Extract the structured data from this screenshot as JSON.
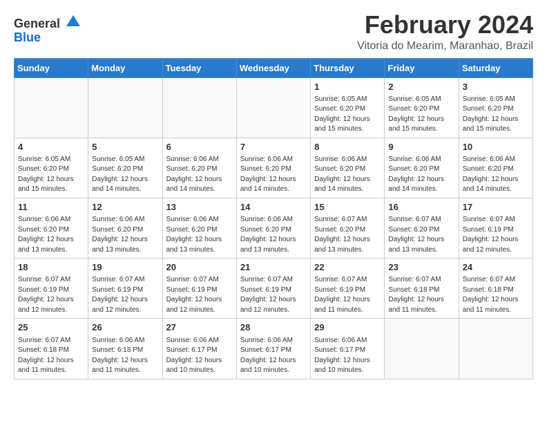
{
  "header": {
    "logo_line1": "General",
    "logo_line2": "Blue",
    "main_title": "February 2024",
    "subtitle": "Vitoria do Mearim, Maranhao, Brazil"
  },
  "weekdays": [
    "Sunday",
    "Monday",
    "Tuesday",
    "Wednesday",
    "Thursday",
    "Friday",
    "Saturday"
  ],
  "weeks": [
    [
      {
        "day": "",
        "info": ""
      },
      {
        "day": "",
        "info": ""
      },
      {
        "day": "",
        "info": ""
      },
      {
        "day": "",
        "info": ""
      },
      {
        "day": "1",
        "info": "Sunrise: 6:05 AM\nSunset: 6:20 PM\nDaylight: 12 hours\nand 15 minutes."
      },
      {
        "day": "2",
        "info": "Sunrise: 6:05 AM\nSunset: 6:20 PM\nDaylight: 12 hours\nand 15 minutes."
      },
      {
        "day": "3",
        "info": "Sunrise: 6:05 AM\nSunset: 6:20 PM\nDaylight: 12 hours\nand 15 minutes."
      }
    ],
    [
      {
        "day": "4",
        "info": "Sunrise: 6:05 AM\nSunset: 6:20 PM\nDaylight: 12 hours\nand 15 minutes."
      },
      {
        "day": "5",
        "info": "Sunrise: 6:05 AM\nSunset: 6:20 PM\nDaylight: 12 hours\nand 14 minutes."
      },
      {
        "day": "6",
        "info": "Sunrise: 6:06 AM\nSunset: 6:20 PM\nDaylight: 12 hours\nand 14 minutes."
      },
      {
        "day": "7",
        "info": "Sunrise: 6:06 AM\nSunset: 6:20 PM\nDaylight: 12 hours\nand 14 minutes."
      },
      {
        "day": "8",
        "info": "Sunrise: 6:06 AM\nSunset: 6:20 PM\nDaylight: 12 hours\nand 14 minutes."
      },
      {
        "day": "9",
        "info": "Sunrise: 6:06 AM\nSunset: 6:20 PM\nDaylight: 12 hours\nand 14 minutes."
      },
      {
        "day": "10",
        "info": "Sunrise: 6:06 AM\nSunset: 6:20 PM\nDaylight: 12 hours\nand 14 minutes."
      }
    ],
    [
      {
        "day": "11",
        "info": "Sunrise: 6:06 AM\nSunset: 6:20 PM\nDaylight: 12 hours\nand 13 minutes."
      },
      {
        "day": "12",
        "info": "Sunrise: 6:06 AM\nSunset: 6:20 PM\nDaylight: 12 hours\nand 13 minutes."
      },
      {
        "day": "13",
        "info": "Sunrise: 6:06 AM\nSunset: 6:20 PM\nDaylight: 12 hours\nand 13 minutes."
      },
      {
        "day": "14",
        "info": "Sunrise: 6:06 AM\nSunset: 6:20 PM\nDaylight: 12 hours\nand 13 minutes."
      },
      {
        "day": "15",
        "info": "Sunrise: 6:07 AM\nSunset: 6:20 PM\nDaylight: 12 hours\nand 13 minutes."
      },
      {
        "day": "16",
        "info": "Sunrise: 6:07 AM\nSunset: 6:20 PM\nDaylight: 12 hours\nand 13 minutes."
      },
      {
        "day": "17",
        "info": "Sunrise: 6:07 AM\nSunset: 6:19 PM\nDaylight: 12 hours\nand 12 minutes."
      }
    ],
    [
      {
        "day": "18",
        "info": "Sunrise: 6:07 AM\nSunset: 6:19 PM\nDaylight: 12 hours\nand 12 minutes."
      },
      {
        "day": "19",
        "info": "Sunrise: 6:07 AM\nSunset: 6:19 PM\nDaylight: 12 hours\nand 12 minutes."
      },
      {
        "day": "20",
        "info": "Sunrise: 6:07 AM\nSunset: 6:19 PM\nDaylight: 12 hours\nand 12 minutes."
      },
      {
        "day": "21",
        "info": "Sunrise: 6:07 AM\nSunset: 6:19 PM\nDaylight: 12 hours\nand 12 minutes."
      },
      {
        "day": "22",
        "info": "Sunrise: 6:07 AM\nSunset: 6:19 PM\nDaylight: 12 hours\nand 11 minutes."
      },
      {
        "day": "23",
        "info": "Sunrise: 6:07 AM\nSunset: 6:18 PM\nDaylight: 12 hours\nand 11 minutes."
      },
      {
        "day": "24",
        "info": "Sunrise: 6:07 AM\nSunset: 6:18 PM\nDaylight: 12 hours\nand 11 minutes."
      }
    ],
    [
      {
        "day": "25",
        "info": "Sunrise: 6:07 AM\nSunset: 6:18 PM\nDaylight: 12 hours\nand 11 minutes."
      },
      {
        "day": "26",
        "info": "Sunrise: 6:06 AM\nSunset: 6:18 PM\nDaylight: 12 hours\nand 11 minutes."
      },
      {
        "day": "27",
        "info": "Sunrise: 6:06 AM\nSunset: 6:17 PM\nDaylight: 12 hours\nand 10 minutes."
      },
      {
        "day": "28",
        "info": "Sunrise: 6:06 AM\nSunset: 6:17 PM\nDaylight: 12 hours\nand 10 minutes."
      },
      {
        "day": "29",
        "info": "Sunrise: 6:06 AM\nSunset: 6:17 PM\nDaylight: 12 hours\nand 10 minutes."
      },
      {
        "day": "",
        "info": ""
      },
      {
        "day": "",
        "info": ""
      }
    ]
  ]
}
